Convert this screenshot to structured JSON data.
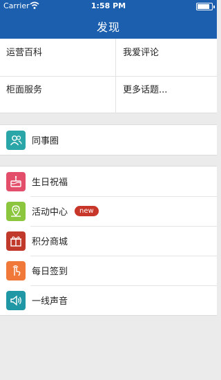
{
  "status_bar": {
    "carrier": "Carrier",
    "time": "1:58 PM"
  },
  "header": {
    "title": "发现"
  },
  "grid": [
    "运营百科",
    "我爱评论",
    "柜面服务",
    "更多话题..."
  ],
  "section1": [
    {
      "label": "同事圈",
      "icon": "colleagues-icon",
      "color": "#2aa6a8"
    }
  ],
  "section2": [
    {
      "label": "生日祝福",
      "icon": "birthday-cake-icon",
      "color": "#e34e6b"
    },
    {
      "label": "活动中心",
      "icon": "activity-location-icon",
      "color": "#8cc63f",
      "badge": "new"
    },
    {
      "label": "积分商城",
      "icon": "gift-icon",
      "color": "#c0392b"
    },
    {
      "label": "每日签到",
      "icon": "finger-tap-icon",
      "color": "#f0793a"
    },
    {
      "label": "一线声音",
      "icon": "speaker-icon",
      "color": "#1f97a4"
    }
  ]
}
